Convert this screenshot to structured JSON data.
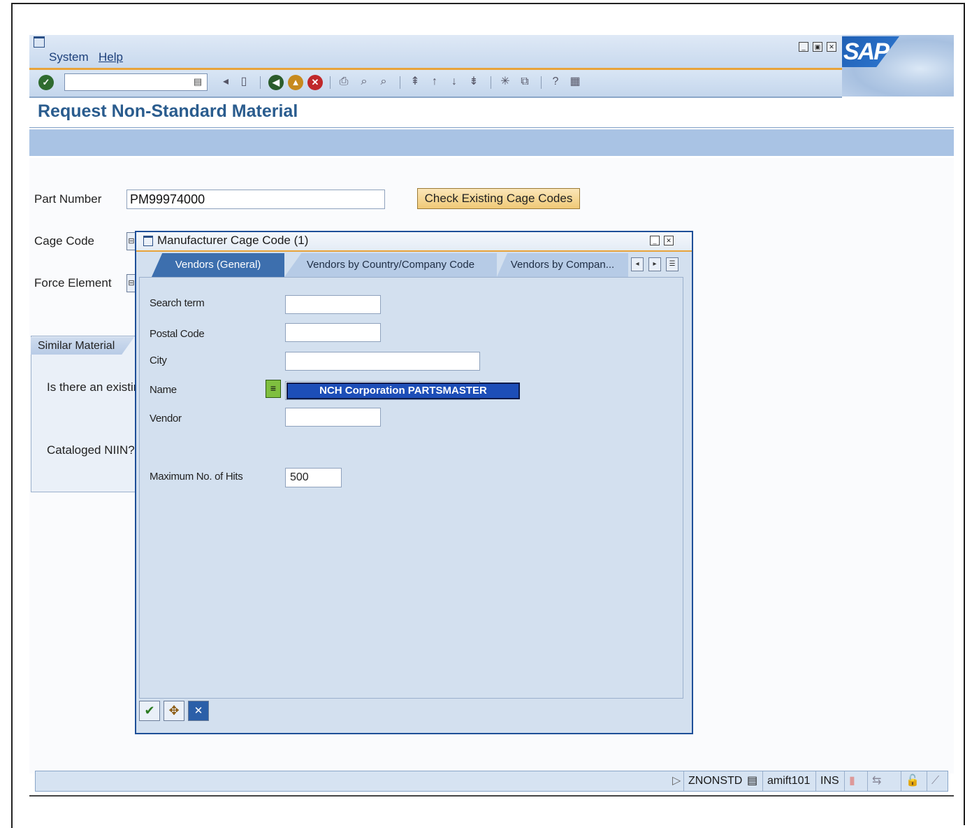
{
  "menu": {
    "system": "System",
    "help": "Help"
  },
  "logo": {
    "text": "SAP"
  },
  "page_title": "Request Non-Standard Material",
  "form": {
    "part_number_label": "Part Number",
    "part_number_value": "PM99974000",
    "check_button": "Check Existing Cage Codes",
    "cage_code_label": "Cage Code",
    "force_element_label": "Force Element"
  },
  "similar": {
    "tab_label": "Similar Material",
    "question1": "Is there an existin",
    "question2": "Cataloged NIIN?"
  },
  "dialog": {
    "title": "Manufacturer Cage Code (1)",
    "tabs": [
      {
        "label": "Vendors (General)"
      },
      {
        "label": "Vendors by Country/Company Code"
      },
      {
        "label": "Vendors by Compan..."
      }
    ],
    "fields": {
      "search_term": "Search term",
      "postal_code": "Postal Code",
      "city": "City",
      "name": "Name",
      "vendor": "Vendor",
      "max_hits": "Maximum No. of Hits",
      "max_hits_value": "500"
    },
    "name_popup": "NCH Corporation PARTSMASTER"
  },
  "status": {
    "transaction": "ZNONSTD",
    "user": "amift101",
    "mode": "INS"
  },
  "colors": {
    "accent": "#e8a33a",
    "title": "#2a5c8e",
    "dialog_border": "#1e4f98",
    "popup": "#1d4eb8"
  }
}
